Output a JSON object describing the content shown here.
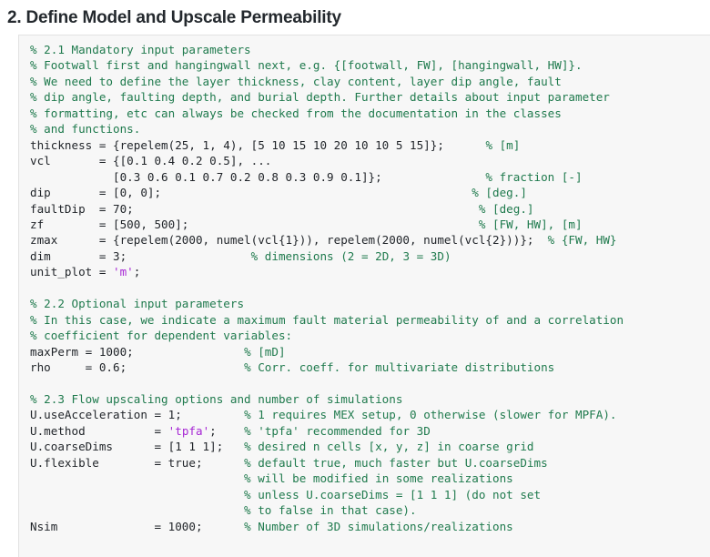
{
  "heading": "2. Define Model and Upscale Permeability",
  "colors": {
    "comment": "#1f7a4d",
    "string": "#a626d4",
    "code": "#1f2328",
    "code_background": "#f7f7f7",
    "page_background": "#ffffff",
    "heading": "#24292e"
  },
  "code": {
    "language": "matlab",
    "lines": [
      {
        "type": "comment",
        "text": "% 2.1 Mandatory input parameters"
      },
      {
        "type": "comment",
        "text": "% Footwall first and hangingwall next, e.g. {[footwall, FW], [hangingwall, HW]}."
      },
      {
        "type": "comment",
        "text": "% We need to define the layer thickness, clay content, layer dip angle, fault"
      },
      {
        "type": "comment",
        "text": "% dip angle, faulting depth, and burial depth. Further details about input parameter"
      },
      {
        "type": "comment",
        "text": "% formatting, etc can always be checked from the documentation in the classes"
      },
      {
        "type": "comment",
        "text": "% and functions."
      },
      {
        "type": "code",
        "code": "thickness = {repelem(25, 1, 4), [5 10 15 10 20 10 10 5 15]};",
        "comment": "% [m]",
        "comment_col": 66
      },
      {
        "type": "code",
        "code": "vcl       = {[0.1 0.4 0.2 0.5], ...",
        "comment": "",
        "comment_col": 0
      },
      {
        "type": "code",
        "code": "            [0.3 0.6 0.1 0.7 0.2 0.8 0.3 0.9 0.1]};",
        "comment": "% fraction [-]",
        "comment_col": 66
      },
      {
        "type": "code",
        "code": "dip       = [0, 0];",
        "comment": "% [deg.]",
        "comment_col": 64
      },
      {
        "type": "code",
        "code": "faultDip  = 70;",
        "comment": "% [deg.]",
        "comment_col": 65
      },
      {
        "type": "code",
        "code": "zf        = [500, 500];",
        "comment": "% [FW, HW], [m]",
        "comment_col": 65
      },
      {
        "type": "code",
        "code": "zmax      = {repelem(2000, numel(vcl{1})), repelem(2000, numel(vcl{2}))};",
        "comment": "% {FW, HW}",
        "comment_col": 75
      },
      {
        "type": "code",
        "code": "dim       = 3;",
        "comment": "% dimensions (2 = 2D, 3 = 3D)",
        "comment_col": 32
      },
      {
        "type": "code",
        "code": "unit_plot = 'm';",
        "comment": "",
        "comment_col": 0,
        "string": "'m'"
      },
      {
        "type": "blank",
        "text": ""
      },
      {
        "type": "comment",
        "text": "% 2.2 Optional input parameters"
      },
      {
        "type": "comment",
        "text": "% In this case, we indicate a maximum fault material permeability of and a correlation"
      },
      {
        "type": "comment",
        "text": "% coefficient for dependent variables:"
      },
      {
        "type": "code",
        "code": "maxPerm = 1000;",
        "comment": "% [mD]",
        "comment_col": 31
      },
      {
        "type": "code",
        "code": "rho     = 0.6;",
        "comment": "% Corr. coeff. for multivariate distributions",
        "comment_col": 31
      },
      {
        "type": "blank",
        "text": ""
      },
      {
        "type": "comment",
        "text": "% 2.3 Flow upscaling options and number of simulations"
      },
      {
        "type": "code",
        "code": "U.useAcceleration = 1;",
        "comment": "% 1 requires MEX setup, 0 otherwise (slower for MPFA).",
        "comment_col": 31
      },
      {
        "type": "code",
        "code": "U.method          = 'tpfa';",
        "comment": "% 'tpfa' recommended for 3D",
        "comment_col": 31,
        "string": "'tpfa'"
      },
      {
        "type": "code",
        "code": "U.coarseDims      = [1 1 1];",
        "comment": "% desired n cells [x, y, z] in coarse grid",
        "comment_col": 31
      },
      {
        "type": "code",
        "code": "U.flexible        = true;",
        "comment": "% default true, much faster but U.coarseDims",
        "comment_col": 31
      },
      {
        "type": "code",
        "code": "",
        "comment": "% will be modified in some realizations",
        "comment_col": 31
      },
      {
        "type": "code",
        "code": "",
        "comment": "% unless U.coarseDims = [1 1 1] (do not set",
        "comment_col": 31
      },
      {
        "type": "code",
        "code": "",
        "comment": "% to false in that case).",
        "comment_col": 31
      },
      {
        "type": "code",
        "code": "Nsim              = 1000;",
        "comment": "% Number of 3D simulations/realizations",
        "comment_col": 31
      }
    ]
  }
}
